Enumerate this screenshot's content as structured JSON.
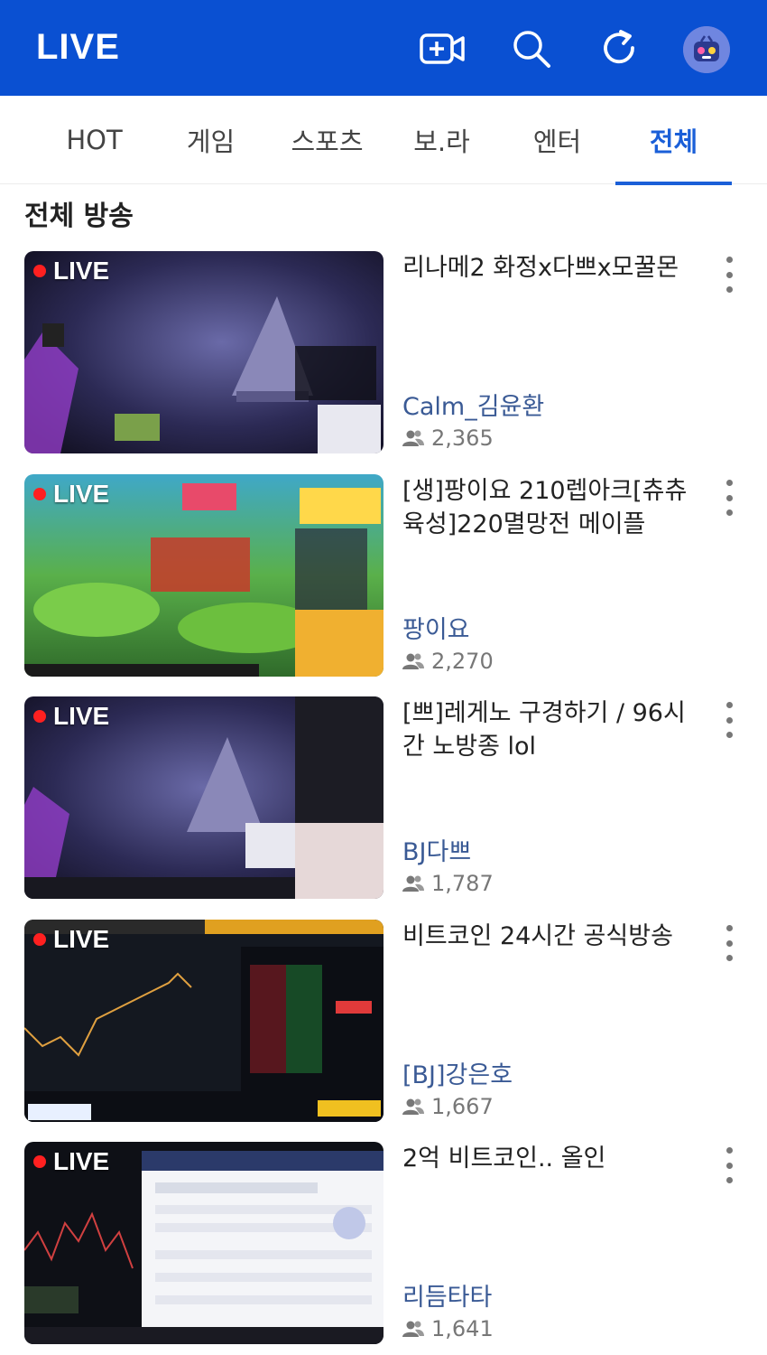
{
  "header": {
    "title": "LIVE",
    "icons": [
      "broadcast-camera-icon",
      "search-icon",
      "refresh-icon",
      "profile-avatar"
    ],
    "bg_color": "#0a50d2"
  },
  "tabs": [
    {
      "label": "HOT",
      "active": false
    },
    {
      "label": "게임",
      "active": false
    },
    {
      "label": "스포츠",
      "active": false
    },
    {
      "label": "보.라",
      "active": false
    },
    {
      "label": "엔터",
      "active": false
    },
    {
      "label": "전체",
      "active": true
    }
  ],
  "section_title": "전체 방송",
  "live_badge": "LIVE",
  "streams": [
    {
      "title": "리나메2 화정x다쁘x모꿀몬",
      "streamer": "Calm_김윤환",
      "viewers": "2,365",
      "thumb_theme": "cave-purple"
    },
    {
      "title": "[생]팡이요 210렙아크[츄츄육성]220멸망전 메이플",
      "streamer": "팡이요",
      "viewers": "2,270",
      "thumb_theme": "forest-green"
    },
    {
      "title": "[쁘]레게노 구경하기 / 96시간 노방종 lol",
      "streamer": "BJ다쁘",
      "viewers": "1,787",
      "thumb_theme": "cave-purple-cam"
    },
    {
      "title": "비트코인 24시간 공식방송",
      "streamer": "[BJ]강은호",
      "viewers": "1,667",
      "thumb_theme": "trading-chart"
    },
    {
      "title": "2억 비트코인.. 올인",
      "streamer": "리듬타타",
      "viewers": "1,641",
      "thumb_theme": "trading-table"
    }
  ],
  "colors": {
    "accent": "#1a5fd8",
    "streamer_name": "#3a5a95",
    "live_dot": "#ff2020"
  }
}
